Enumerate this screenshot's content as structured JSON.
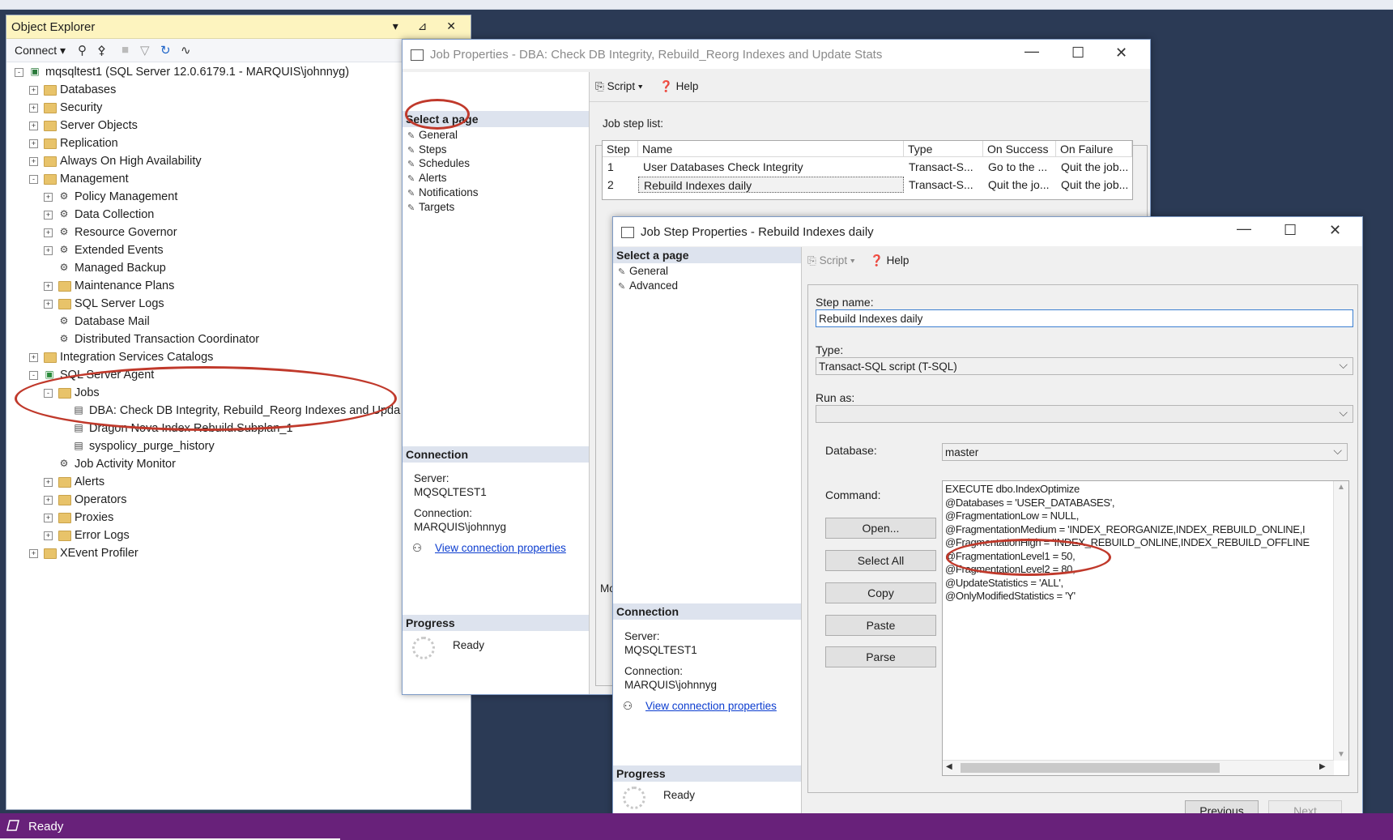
{
  "status": {
    "text": "Ready"
  },
  "object_explorer": {
    "title": "Object Explorer",
    "connect_label": "Connect",
    "title_buttons": "▾ ⊿ ✕",
    "tree": [
      {
        "label": "mqsqltest1 (SQL Server 12.0.6179.1 - MARQUIS\\johnnyg)",
        "type": "server"
      },
      {
        "label": "Databases",
        "type": "folder"
      },
      {
        "label": "Security",
        "type": "folder"
      },
      {
        "label": "Server Objects",
        "type": "folder"
      },
      {
        "label": "Replication",
        "type": "folder"
      },
      {
        "label": "Always On High Availability",
        "type": "folder"
      },
      {
        "label": "Management",
        "type": "folder"
      },
      {
        "label": "Policy Management",
        "type": "icon"
      },
      {
        "label": "Data Collection",
        "type": "icon"
      },
      {
        "label": "Resource Governor",
        "type": "icon"
      },
      {
        "label": "Extended Events",
        "type": "icon"
      },
      {
        "label": "Managed Backup",
        "type": "icon"
      },
      {
        "label": "Maintenance Plans",
        "type": "folder"
      },
      {
        "label": "SQL Server Logs",
        "type": "folder"
      },
      {
        "label": "Database Mail",
        "type": "icon"
      },
      {
        "label": "Distributed Transaction Coordinator",
        "type": "icon"
      },
      {
        "label": "Integration Services Catalogs",
        "type": "folder"
      },
      {
        "label": "SQL Server Agent",
        "type": "agent"
      },
      {
        "label": "Jobs",
        "type": "folder"
      },
      {
        "label": "DBA:  Check DB Integrity, Rebuild_Reorg Indexes and Upda",
        "type": "job"
      },
      {
        "label": "Dragon Nova Index Rebuild.Subplan_1",
        "type": "job"
      },
      {
        "label": "syspolicy_purge_history",
        "type": "job"
      },
      {
        "label": "Job Activity Monitor",
        "type": "icon"
      },
      {
        "label": "Alerts",
        "type": "folder"
      },
      {
        "label": "Operators",
        "type": "folder"
      },
      {
        "label": "Proxies",
        "type": "folder"
      },
      {
        "label": "Error Logs",
        "type": "folder"
      },
      {
        "label": "XEvent Profiler",
        "type": "folder"
      }
    ]
  },
  "job_properties": {
    "title": "Job Properties - DBA:  Check DB Integrity, Rebuild_Reorg Indexes and Update Stats",
    "select_page": "Select a page",
    "pages": [
      "General",
      "Steps",
      "Schedules",
      "Alerts",
      "Notifications",
      "Targets"
    ],
    "script_label": "Script",
    "help_label": "Help",
    "job_step_list_label": "Job step list:",
    "columns": [
      "Step",
      "Name",
      "Type",
      "On Success",
      "On Failure"
    ],
    "rows": [
      [
        "1",
        "User Databases Check Integrity",
        "Transact-S...",
        "Go to the ...",
        "Quit the job..."
      ],
      [
        "2",
        "Rebuild Indexes daily",
        "Transact-S...",
        "Quit the jo...",
        "Quit the job..."
      ]
    ],
    "connection_header": "Connection",
    "server_label": "Server:",
    "server_value": "MQSQLTEST1",
    "connection_label": "Connection:",
    "connection_value": "MARQUIS\\johnnyg",
    "view_connection_properties": "View connection properties",
    "progress_header": "Progress",
    "progress_status": "Ready",
    "partial_label": "Mo"
  },
  "job_step": {
    "title": "Job Step Properties - Rebuild Indexes daily",
    "select_page": "Select a page",
    "pages": [
      "General",
      "Advanced"
    ],
    "script_label": "Script",
    "help_label": "Help",
    "step_name_label": "Step name:",
    "step_name_value": "Rebuild Indexes daily",
    "type_label": "Type:",
    "type_value": "Transact-SQL script (T-SQL)",
    "run_as_label": "Run as:",
    "run_as_value": "",
    "database_label": "Database:",
    "database_value": "master",
    "command_label": "Command:",
    "buttons": [
      "Open...",
      "Select All",
      "Copy",
      "Paste",
      "Parse"
    ],
    "command_lines": [
      "EXECUTE dbo.IndexOptimize",
      "@Databases = 'USER_DATABASES',",
      "@FragmentationLow = NULL,",
      "@FragmentationMedium = 'INDEX_REORGANIZE,INDEX_REBUILD_ONLINE,I",
      "@FragmentationHigh = 'INDEX_REBUILD_ONLINE,INDEX_REBUILD_OFFLINE",
      "@FragmentationLevel1 = 50,",
      "@FragmentationLevel2 = 80,",
      "@UpdateStatistics = 'ALL',",
      "@OnlyModifiedStatistics = 'Y'"
    ],
    "connection_header": "Connection",
    "server_label": "Server:",
    "server_value": "MQSQLTEST1",
    "connection_label": "Connection:",
    "connection_value": "MARQUIS\\johnnyg",
    "view_connection_properties": "View connection properties",
    "progress_header": "Progress",
    "progress_status": "Ready",
    "previous_label": "Previous",
    "next_label": "Next"
  },
  "colors": {
    "status_bar": "#68217a",
    "annotation_ring": "#c0392b",
    "oe_title": "#fdf4bf",
    "desktop": "#2b3a55"
  }
}
